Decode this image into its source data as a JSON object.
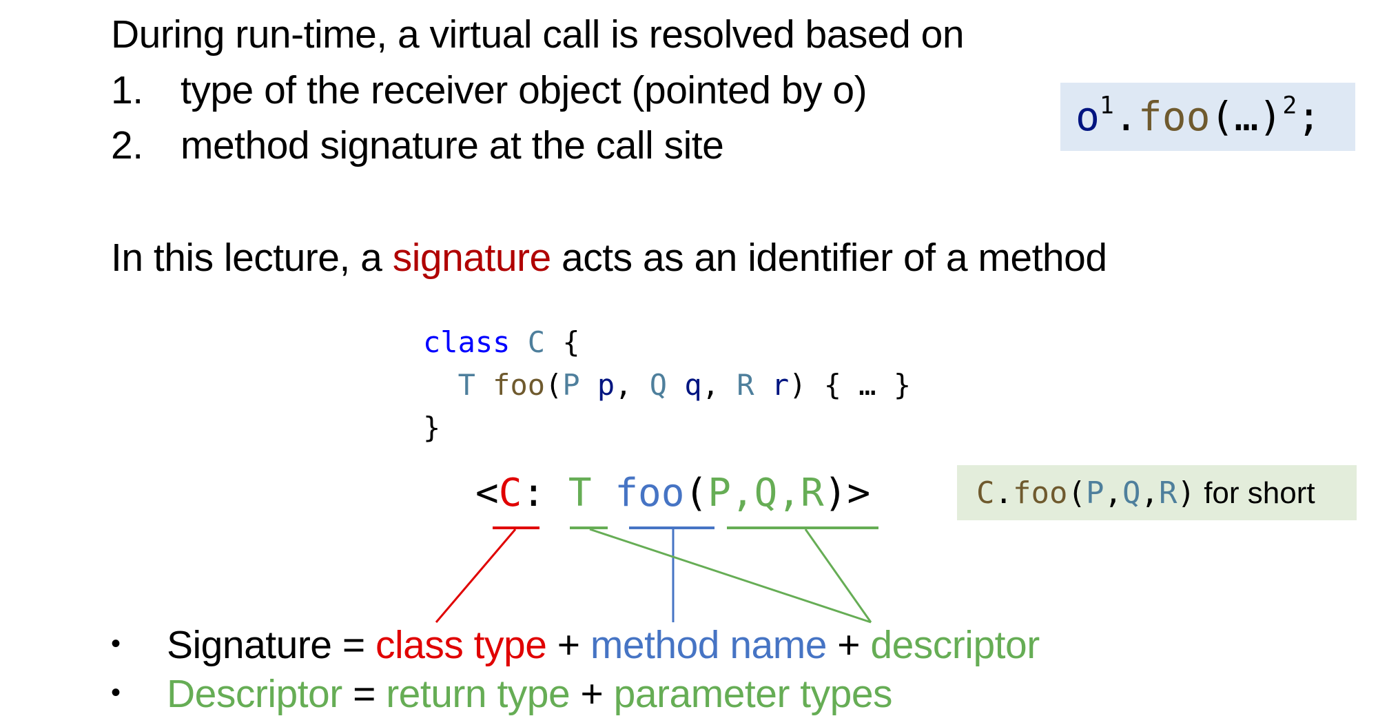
{
  "heading": {
    "line1": "During run-time, a virtual call is resolved based on",
    "items": [
      {
        "number": "1.",
        "text": "type of the receiver object (pointed by o)"
      },
      {
        "number": "2.",
        "text": "method signature at the call site"
      }
    ]
  },
  "call_box": {
    "receiver": "o",
    "receiver_mark": "1",
    "dot": ".",
    "method": "foo",
    "args": "(…)",
    "sig_mark": "2",
    "semi": ";"
  },
  "statement": {
    "prefix": "In this lecture, a ",
    "highlight": "signature",
    "suffix": " acts as an identifier of a method"
  },
  "code": {
    "line1": {
      "keyword": "class",
      "class_name": "C",
      "brace": "{"
    },
    "line2": {
      "indent": "  ",
      "return_type": "T",
      "method": "foo",
      "open": "(",
      "params": [
        {
          "type": "P",
          "name": "p",
          "sep": ", "
        },
        {
          "type": "Q",
          "name": "q",
          "sep": ", "
        },
        {
          "type": "R",
          "name": "r",
          "sep": ""
        }
      ],
      "close": ")",
      "body": " { … }"
    },
    "line3": "}"
  },
  "signature": {
    "open": "<",
    "class_type": "C",
    "colon": ":",
    "return_type": "T",
    "method_name": "foo",
    "paren_open": "(",
    "param_types": "P,Q,R",
    "paren_close": ")",
    "close": ">"
  },
  "short_box": {
    "class_name": "C",
    "dot": ".",
    "method": "foo",
    "open": "(",
    "p": "P",
    "c1": ",",
    "q": "Q",
    "c2": ",",
    "r": "R",
    "close": ")",
    "suffix": " for short"
  },
  "bullets": [
    {
      "symbol": "•",
      "parts": [
        {
          "text": "Signature = ",
          "color": "black"
        },
        {
          "text": "class type",
          "color": "red"
        },
        {
          "text": " + ",
          "color": "black"
        },
        {
          "text": "method name",
          "color": "blue"
        },
        {
          "text": " + ",
          "color": "black"
        },
        {
          "text": "descriptor",
          "color": "green"
        }
      ]
    },
    {
      "symbol": "•",
      "parts": [
        {
          "text": "Descriptor",
          "color": "green"
        },
        {
          "text": " = ",
          "color": "black"
        },
        {
          "text": "return type",
          "color": "green"
        },
        {
          "text": " + ",
          "color": "black"
        },
        {
          "text": "parameter types",
          "color": "green"
        }
      ]
    }
  ],
  "colors": {
    "red": "#e00000",
    "blue": "#4674c4",
    "green": "#66ad55",
    "signature_word": "#b00000",
    "keyword": "#0000ff",
    "type": "#4e7f9c",
    "method": "#6f5a2e",
    "variable": "#001480",
    "call_box_bg": "#dee8f4",
    "short_box_bg": "#e3eddb"
  }
}
